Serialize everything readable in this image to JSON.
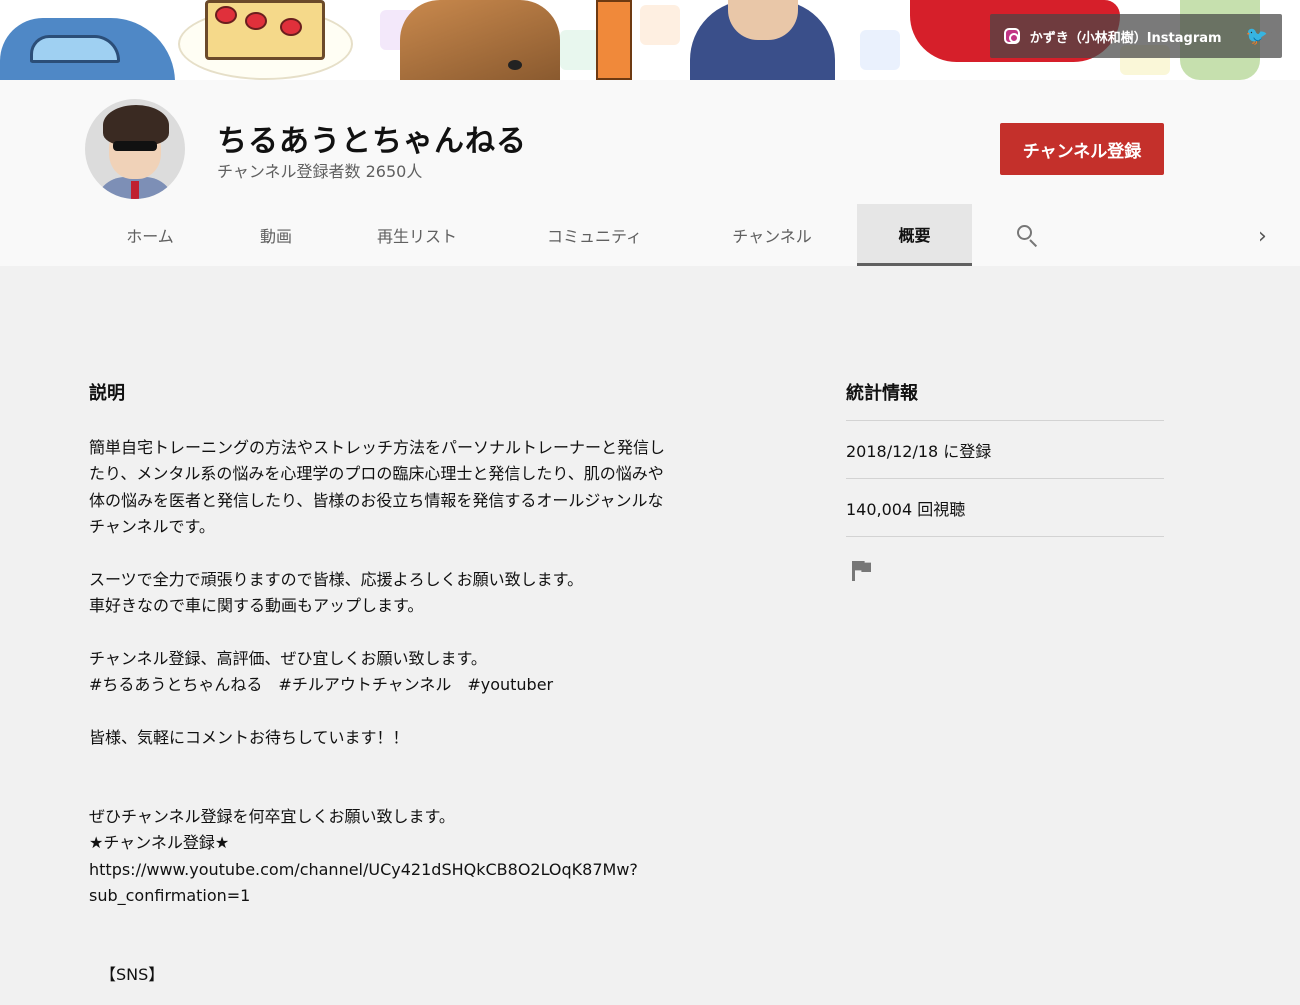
{
  "banner": {
    "link_label": "かずき（小林和樹）Instagram",
    "icons": [
      "instagram-icon",
      "twitter-icon"
    ]
  },
  "channel": {
    "name": "ちるあうとちゃんねる",
    "subscribers": "チャンネル登録者数 2650人",
    "subscribe_label": "チャンネル登録"
  },
  "tabs": [
    {
      "label": "ホーム"
    },
    {
      "label": "動画"
    },
    {
      "label": "再生リスト"
    },
    {
      "label": "コミュニティ"
    },
    {
      "label": "チャンネル"
    },
    {
      "label": "概要",
      "active": true
    }
  ],
  "about": {
    "description_heading": "説明",
    "paragraphs": [
      "簡単自宅トレーニングの方法やストレッチ方法をパーソナルトレーナーと発信し\nたり、メンタル系の悩みを心理学のプロの臨床心理士と発信したり、肌の悩みや\n体の悩みを医者と発信したり、皆様のお役立ち情報を発信するオールジャンルな\nチャンネルです。",
      "スーツで全力で頑張りますので皆様、応援よろしくお願い致します。\n車好きなので車に関する動画もアップします。",
      "チャンネル登録、高評価、ぜひ宜しくお願い致します。\n#ちるあうとちゃんねる　#チルアウトチャンネル　#youtuber",
      "皆様、気軽にコメントお待ちしています！！",
      "ぜひチャンネル登録を何卒宜しくお願い致します。\n★チャンネル登録★\nhttps://www.youtube.com/channel/UCy421dSHQkCB8O2LOqK87Mw?\nsub_confirmation=1",
      "【SNS】"
    ]
  },
  "stats": {
    "heading": "統計情報",
    "joined": "2018/12/18 に登録",
    "views": "140,004 回視聴"
  }
}
